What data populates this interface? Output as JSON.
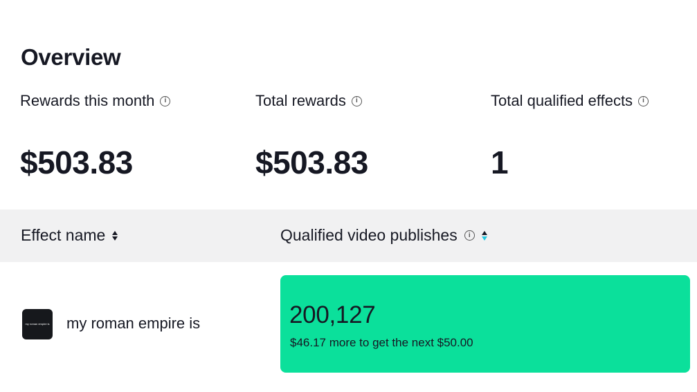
{
  "overview": {
    "title": "Overview",
    "stats": [
      {
        "label": "Rewards this month",
        "value": "$503.83"
      },
      {
        "label": "Total rewards",
        "value": "$503.83"
      },
      {
        "label": "Total qualified effects",
        "value": "1"
      }
    ]
  },
  "table": {
    "columns": [
      {
        "label": "Effect name",
        "sort_state": "none"
      },
      {
        "label": "Qualified video publishes",
        "sort_state": "descending"
      }
    ],
    "rows": [
      {
        "thumbnail_text": "my roman empire is",
        "effect_name": "my roman empire is",
        "qualified_publishes": "200,127",
        "progress_note": "$46.17 more to get the next $50.00"
      }
    ]
  },
  "colors": {
    "progress_card": "#0be09b",
    "sort_active": "#25c8e0",
    "header_bg": "#f1f1f2"
  },
  "icons": {
    "info": "info-circle-icon",
    "sort": "sort-arrows-icon"
  }
}
